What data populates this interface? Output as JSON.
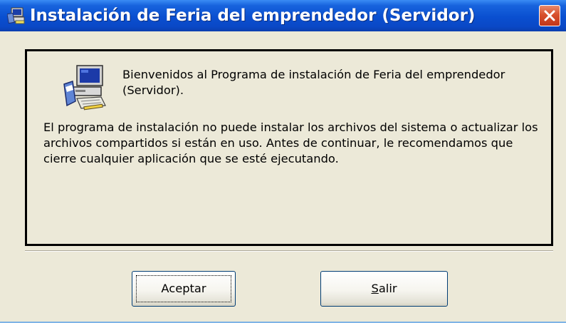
{
  "window": {
    "title": "Instalación de Feria del emprendedor (Servidor)",
    "title_icon": "installer-computer-icon",
    "close_icon": "close-x-icon",
    "titlebar_color": "#0a4fd0",
    "close_color": "#d8502c",
    "background_color": "#ece9d8"
  },
  "content": {
    "icon": "setup-computer-icon",
    "welcome": "Bienvenidos al Programa de instalación de Feria del emprendedor (Servidor).",
    "body": "El programa de instalación no puede instalar los archivos del sistema o actualizar los archivos compartidos si están en uso. Antes de continuar, le recomendamos que cierre cualquier aplicación que se esté ejecutando."
  },
  "buttons": {
    "accept_label": "Aceptar",
    "exit_mnemonic": "S",
    "exit_rest": "alir"
  }
}
